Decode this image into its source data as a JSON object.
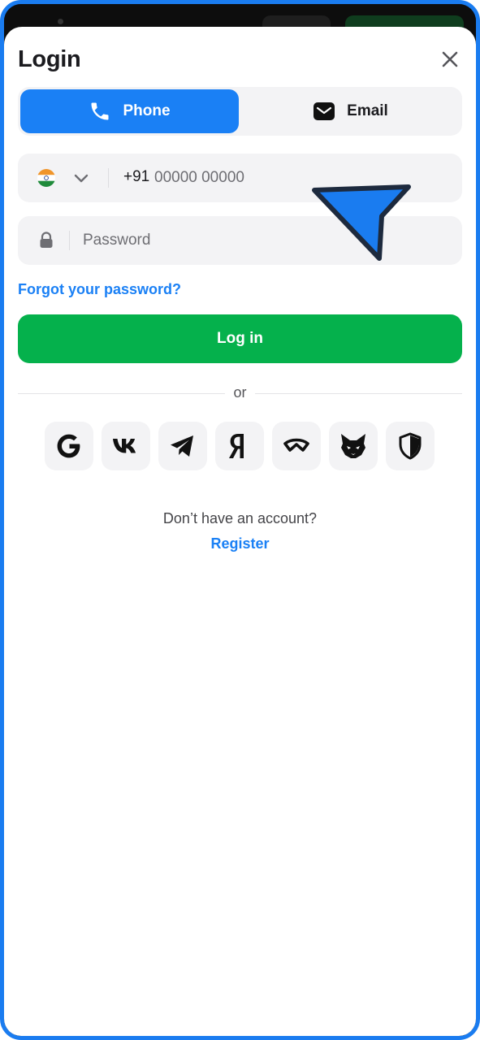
{
  "header": {
    "title": "Login",
    "close_icon": "close-icon"
  },
  "tabs": [
    {
      "label": "Phone",
      "icon": "phone-icon",
      "active": true
    },
    {
      "label": "Email",
      "icon": "mail-icon",
      "active": false
    }
  ],
  "phone_field": {
    "country_icon": "india-flag-icon",
    "prefix": "+91",
    "value": "",
    "placeholder": "00000 00000"
  },
  "password_field": {
    "icon": "lock-icon",
    "value": "",
    "placeholder": "Password"
  },
  "forgot_link": "Forgot your password?",
  "login_button": "Log in",
  "divider_text": "or",
  "social_logins": [
    {
      "name": "google",
      "icon": "google-icon"
    },
    {
      "name": "vk",
      "icon": "vk-icon"
    },
    {
      "name": "telegram",
      "icon": "telegram-icon"
    },
    {
      "name": "yandex",
      "icon": "yandex-icon"
    },
    {
      "name": "walletconnect",
      "icon": "walletconnect-icon"
    },
    {
      "name": "metamask",
      "icon": "metamask-icon"
    },
    {
      "name": "shield",
      "icon": "shield-icon"
    }
  ],
  "footer": {
    "question": "Don’t have an account?",
    "register_link": "Register"
  },
  "colors": {
    "primary_blue": "#1a80f5",
    "login_green": "#05b14c",
    "field_bg": "#f3f3f5",
    "text_dark": "#1b1b1f"
  }
}
